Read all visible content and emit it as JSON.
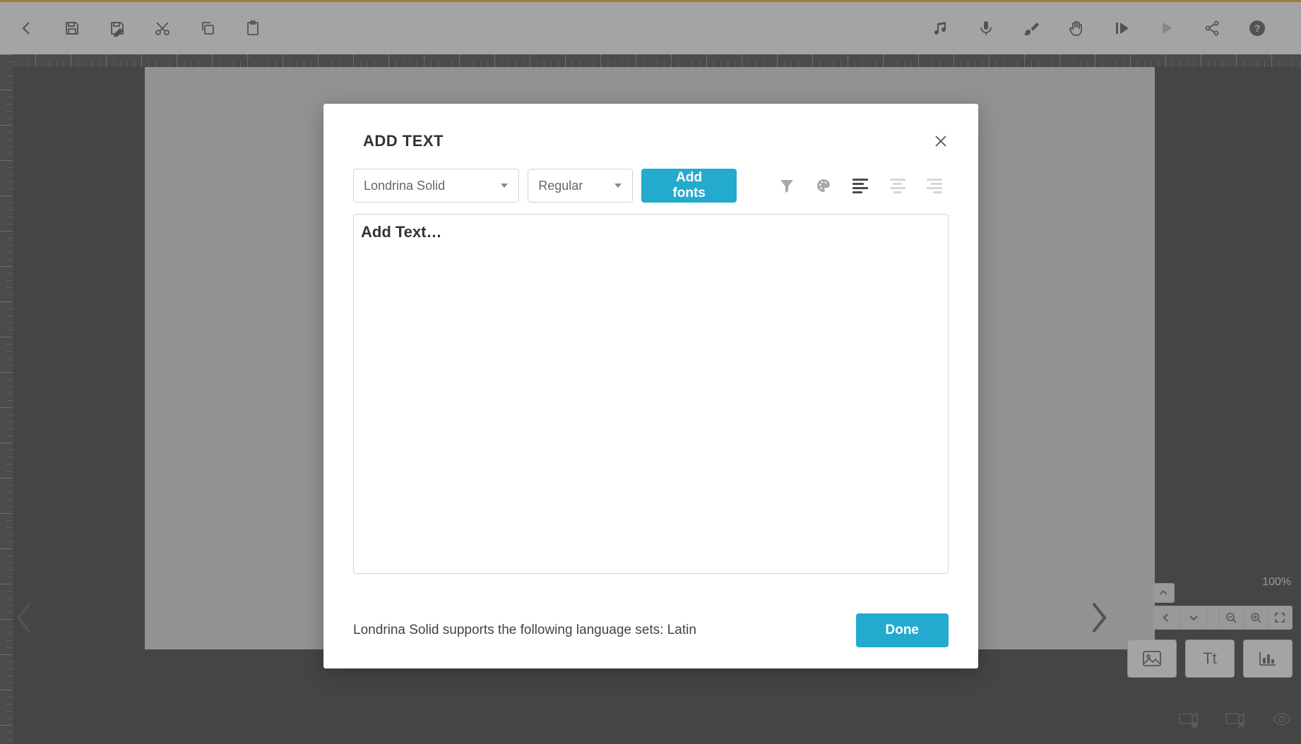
{
  "toolbar_icons": {
    "back": "back-icon",
    "save": "save-icon",
    "save_as": "save-as-icon",
    "cut": "cut-icon",
    "copy": "copy-icon",
    "paste": "paste-icon",
    "audio": "music-icon",
    "record": "mic-icon",
    "brush": "brush-icon",
    "pan": "hand-icon",
    "play_from": "play-from-icon",
    "play": "play-icon",
    "share": "share-icon",
    "help": "help-icon"
  },
  "zoom": {
    "percent": "100%"
  },
  "action_buttons": {
    "image": "image-button",
    "text_label": "Tt",
    "chart": "chart-button"
  },
  "modal": {
    "title": "ADD TEXT",
    "font_family": "Londrina Solid",
    "font_style": "Regular",
    "add_fonts_label": "Add fonts",
    "text_placeholder": "Add Text…",
    "help_text": "Londrina Solid supports the following language sets: Latin",
    "done_label": "Done"
  },
  "colors": {
    "accent": "#f5a623",
    "primary": "#25aacf"
  }
}
